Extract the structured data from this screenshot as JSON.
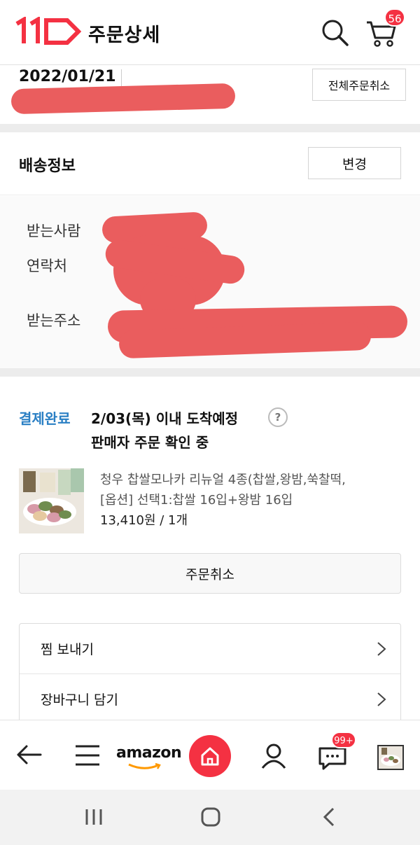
{
  "header": {
    "logo_text": "11",
    "title": "주문상세",
    "search_icon": "search-icon",
    "cart_icon": "cart-icon",
    "cart_badge": "56",
    "brand_color": "#f43142"
  },
  "order": {
    "date": "2022/01/21",
    "cancel_all_label": "전체주문취소"
  },
  "shipping": {
    "title": "배송정보",
    "change_label": "변경",
    "recipient_label": "받는사람",
    "contact_label": "연락처",
    "address_label": "받는주소"
  },
  "status": {
    "tag": "결제완료",
    "arrival": "2/03(목) 이내 도착예정",
    "help": "?",
    "seller_status": "판매자 주문 확인 중",
    "tag_color": "#2a7fc4"
  },
  "product": {
    "name": "청우 찹쌀모나카 리뉴얼 4종(찹쌀,왕밤,쑥찰떡,",
    "option": "[옵션] 선택1:찹쌀 16입+왕밤 16입",
    "price": "13,410원 / 1개"
  },
  "actions": {
    "order_cancel_label": "주문취소",
    "menu": [
      {
        "label": "찜 보내기"
      },
      {
        "label": "장바구니 담기"
      }
    ]
  },
  "bottom_nav": {
    "amazon_label": "amazon",
    "chat_badge": "99+",
    "items": [
      "back-icon",
      "menu-icon",
      "amazon-logo",
      "home-icon",
      "user-icon",
      "chat-icon",
      "recent-item-thumb"
    ]
  },
  "system_nav": {
    "items": [
      "recent-apps-icon",
      "home-icon",
      "back-icon"
    ]
  }
}
